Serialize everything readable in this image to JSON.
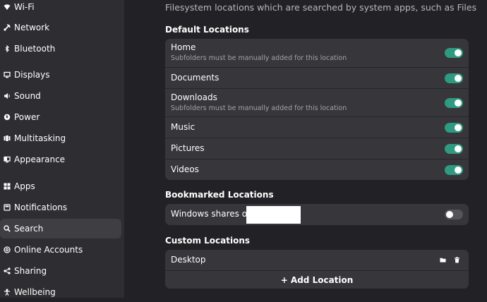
{
  "sidebar": {
    "items": [
      {
        "label": "Wi-Fi",
        "icon": "wifi-icon"
      },
      {
        "label": "Network",
        "icon": "network-icon"
      },
      {
        "label": "Bluetooth",
        "icon": "bluetooth-icon"
      },
      {
        "label": "Displays",
        "icon": "display-icon"
      },
      {
        "label": "Sound",
        "icon": "sound-icon"
      },
      {
        "label": "Power",
        "icon": "power-icon"
      },
      {
        "label": "Multitasking",
        "icon": "multitasking-icon"
      },
      {
        "label": "Appearance",
        "icon": "appearance-icon"
      },
      {
        "label": "Apps",
        "icon": "apps-icon"
      },
      {
        "label": "Notifications",
        "icon": "bell-icon"
      },
      {
        "label": "Search",
        "icon": "search-icon",
        "active": true
      },
      {
        "label": "Online Accounts",
        "icon": "at-icon"
      },
      {
        "label": "Sharing",
        "icon": "share-icon"
      },
      {
        "label": "Wellbeing",
        "icon": "wellbeing-icon"
      }
    ]
  },
  "main": {
    "description": "Filesystem locations which are searched by system apps, such as Files",
    "default_heading": "Default Locations",
    "default_locations": [
      {
        "title": "Home",
        "subtitle": "Subfolders must be manually added for this location",
        "enabled": true
      },
      {
        "title": "Documents",
        "subtitle": "",
        "enabled": true
      },
      {
        "title": "Downloads",
        "subtitle": "Subfolders must be manually added for this location",
        "enabled": true
      },
      {
        "title": "Music",
        "subtitle": "",
        "enabled": true
      },
      {
        "title": "Pictures",
        "subtitle": "",
        "enabled": true
      },
      {
        "title": "Videos",
        "subtitle": "",
        "enabled": true
      }
    ],
    "bookmarked_heading": "Bookmarked Locations",
    "bookmarked": {
      "title": "Windows shares on",
      "enabled": false
    },
    "custom_heading": "Custom Locations",
    "custom": {
      "title": "Desktop"
    },
    "add_location_label": "+ Add Location"
  },
  "colors": {
    "accent": "#2f9a82",
    "background": "#222226",
    "sidebar": "#2e2e32",
    "card": "#36363b"
  }
}
